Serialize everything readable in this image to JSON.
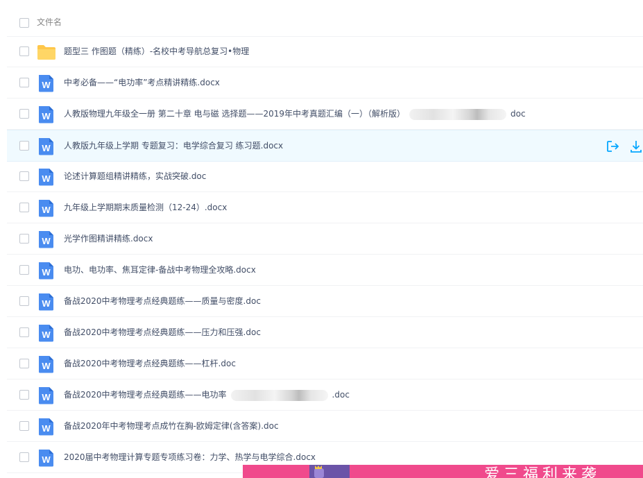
{
  "top_link_text": "",
  "header": {
    "column_label": "文件名"
  },
  "files": [
    {
      "type": "folder",
      "name": "题型三 作图题（精练）-名校中考导航总复习•物理"
    },
    {
      "type": "word",
      "name": "中考必备——“电功率”考点精讲精练.docx"
    },
    {
      "type": "word",
      "name": "人教版物理九年级全一册 第二十章 电与磁 选择题——2019年中考真题汇编（一）（解析版）",
      "suffix": "doc",
      "blurred": true
    },
    {
      "type": "word",
      "name": "人教版九年级上学期 专题复习：电学综合复习 练习题.docx",
      "selected": true
    },
    {
      "type": "word",
      "name": "论述计算题组精讲精练，实战突破.doc"
    },
    {
      "type": "word",
      "name": "九年级上学期期末质量检测（12-24）.docx"
    },
    {
      "type": "word",
      "name": "光学作图精讲精练.docx"
    },
    {
      "type": "word",
      "name": "电功、电功率、焦耳定律-备战中考物理全攻略.docx"
    },
    {
      "type": "word",
      "name": "备战2020中考物理考点经典题练——质量与密度.doc"
    },
    {
      "type": "word",
      "name": "备战2020中考物理考点经典题练——压力和压强.doc"
    },
    {
      "type": "word",
      "name": "备战2020中考物理考点经典题练——杠杆.doc"
    },
    {
      "type": "word",
      "name": "备战2020中考物理考点经典题练——电功率",
      "suffix": ".doc",
      "blurred": true
    },
    {
      "type": "word",
      "name": "备战2020年中考物理考点成竹在胸-欧姆定律(含答案).doc"
    },
    {
      "type": "word",
      "name": "2020届中考物理计算专题专项练习卷：力学、热学与电学综合.docx"
    }
  ],
  "colors": {
    "accent": "#06a7ff",
    "word_icon": "#4a8cf0",
    "folder_icon": "#ffc74a",
    "banner": "#f04a8c"
  },
  "icons": {
    "folder": "folder-icon",
    "word": "word-doc-icon",
    "share": "share-icon",
    "download": "download-icon"
  },
  "banner": {
    "text": "爱三福利来袭"
  }
}
